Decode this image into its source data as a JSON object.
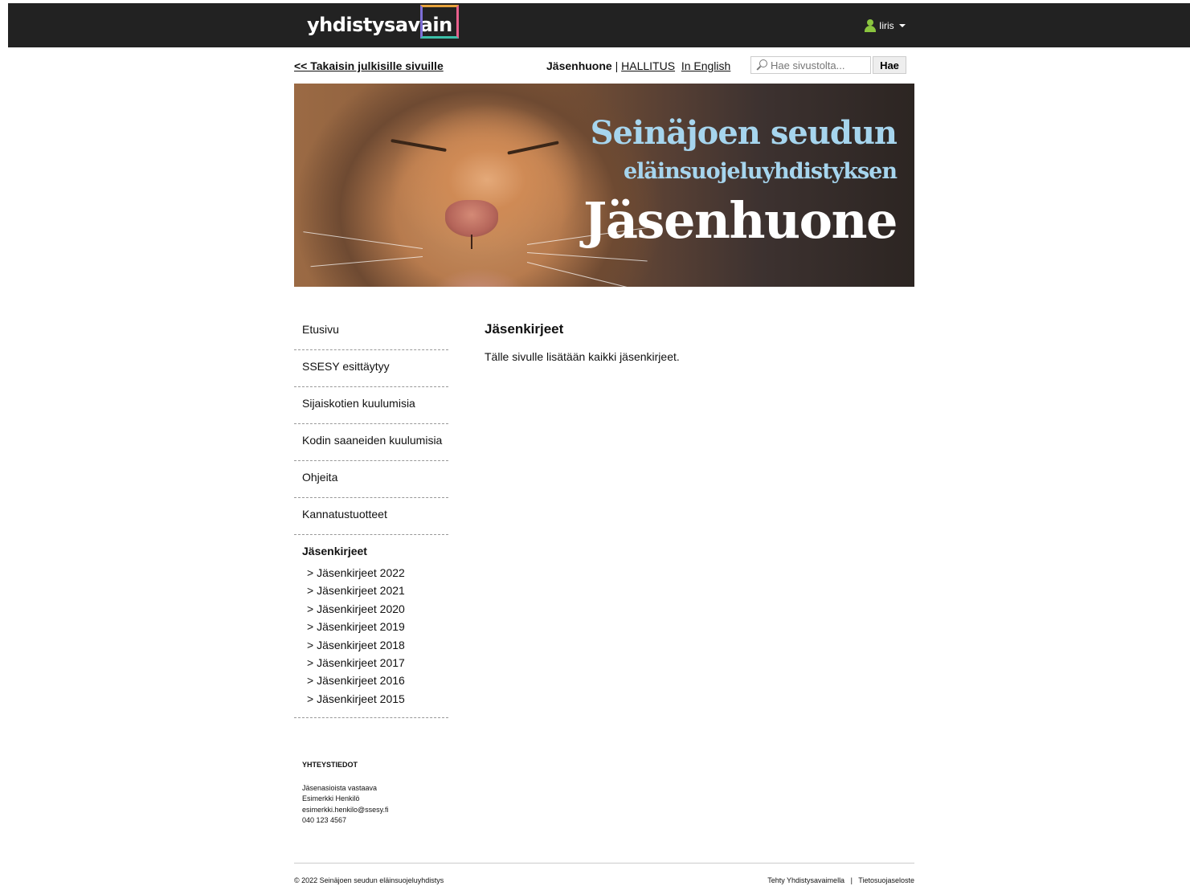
{
  "topbar": {
    "logo_text": "yhdistysavain",
    "user_name": "Iiris"
  },
  "subnav": {
    "back_link": "<< Takaisin julkisille sivuille",
    "current_section": "Jäsenhuone",
    "separator": "|",
    "board_link": "HALLITUS",
    "english_link": "In English",
    "search_placeholder": "Hae sivustolta...",
    "search_button": "Hae"
  },
  "banner": {
    "line1": "Seinäjoen seudun",
    "line2": "eläinsuojeluyhdistyksen",
    "line3": "Jäsenhuone"
  },
  "sidebar": {
    "items": [
      {
        "label": "Etusivu"
      },
      {
        "label": "SSESY esittäytyy"
      },
      {
        "label": "Sijaiskotien kuulumisia"
      },
      {
        "label": "Kodin saaneiden kuulumisia"
      },
      {
        "label": "Ohjeita"
      },
      {
        "label": "Kannatustuotteet"
      }
    ],
    "active_item": "Jäsenkirjeet",
    "sub_items": [
      "> Jäsenkirjeet 2022",
      "> Jäsenkirjeet 2021",
      "> Jäsenkirjeet 2020",
      "> Jäsenkirjeet 2019",
      "> Jäsenkirjeet 2018",
      "> Jäsenkirjeet 2017",
      "> Jäsenkirjeet 2016",
      "> Jäsenkirjeet 2015"
    ]
  },
  "contact": {
    "heading": "YHTEYSTIEDOT",
    "role": "Jäsenasioista vastaava",
    "name": "Esimerkki Henkilö",
    "email": "esimerkki.henkilo@ssesy.fi",
    "phone": "040 123 4567"
  },
  "content": {
    "title": "Jäsenkirjeet",
    "text": "Tälle sivulle lisätään kaikki jäsenkirjeet."
  },
  "footer": {
    "copyright": "© 2022 Seinäjoen seudun eläinsuojeluyhdistys",
    "made_with": "Tehty Yhdistysavaimella",
    "separator": "|",
    "privacy": "Tietosuojaseloste"
  },
  "colors": {
    "topbar_bg": "#222222",
    "banner_text_light_blue": "#a6d5ee",
    "user_icon_green": "#8bc53f"
  }
}
